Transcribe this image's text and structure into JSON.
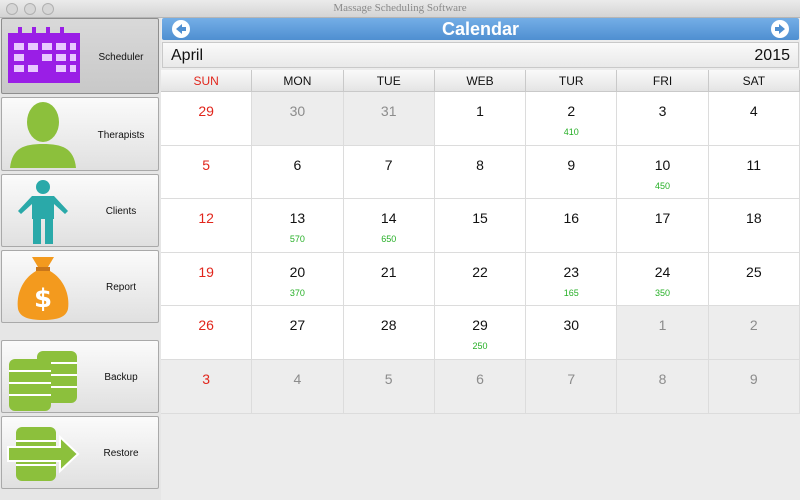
{
  "window": {
    "title": "Massage Scheduling Software"
  },
  "sidebar": {
    "items": [
      {
        "label": "Scheduler",
        "icon": "calendar-icon",
        "active": true
      },
      {
        "label": "Therapists",
        "icon": "person-icon",
        "active": false
      },
      {
        "label": "Clients",
        "icon": "client-icon",
        "active": false
      },
      {
        "label": "Report",
        "icon": "money-bag-icon",
        "active": false
      },
      {
        "label": "Backup",
        "icon": "database-icon",
        "active": false
      },
      {
        "label": "Restore",
        "icon": "restore-icon",
        "active": false
      }
    ]
  },
  "calendar": {
    "title": "Calendar",
    "month": "April",
    "year": "2015",
    "weekdays": [
      "SUN",
      "MON",
      "TUE",
      "WEB",
      "TUR",
      "FRI",
      "SAT"
    ],
    "weeks": [
      [
        {
          "day": "29",
          "current": true
        },
        {
          "day": "30",
          "current": false
        },
        {
          "day": "31",
          "current": false
        },
        {
          "day": "1",
          "current": true
        },
        {
          "day": "2",
          "current": true,
          "amount": "410"
        },
        {
          "day": "3",
          "current": true
        },
        {
          "day": "4",
          "current": true
        }
      ],
      [
        {
          "day": "5",
          "current": true
        },
        {
          "day": "6",
          "current": true
        },
        {
          "day": "7",
          "current": true
        },
        {
          "day": "8",
          "current": true
        },
        {
          "day": "9",
          "current": true
        },
        {
          "day": "10",
          "current": true,
          "amount": "450"
        },
        {
          "day": "11",
          "current": true
        }
      ],
      [
        {
          "day": "12",
          "current": true
        },
        {
          "day": "13",
          "current": true,
          "amount": "570"
        },
        {
          "day": "14",
          "current": true,
          "amount": "650"
        },
        {
          "day": "15",
          "current": true
        },
        {
          "day": "16",
          "current": true
        },
        {
          "day": "17",
          "current": true
        },
        {
          "day": "18",
          "current": true
        }
      ],
      [
        {
          "day": "19",
          "current": true
        },
        {
          "day": "20",
          "current": true,
          "amount": "370"
        },
        {
          "day": "21",
          "current": true
        },
        {
          "day": "22",
          "current": true
        },
        {
          "day": "23",
          "current": true,
          "amount": "165"
        },
        {
          "day": "24",
          "current": true,
          "amount": "350"
        },
        {
          "day": "25",
          "current": true
        }
      ],
      [
        {
          "day": "26",
          "current": true
        },
        {
          "day": "27",
          "current": true
        },
        {
          "day": "28",
          "current": true
        },
        {
          "day": "29",
          "current": true,
          "amount": "250"
        },
        {
          "day": "30",
          "current": true
        },
        {
          "day": "1",
          "current": false
        },
        {
          "day": "2",
          "current": false
        }
      ],
      [
        {
          "day": "3",
          "current": false
        },
        {
          "day": "4",
          "current": false
        },
        {
          "day": "5",
          "current": false
        },
        {
          "day": "6",
          "current": false
        },
        {
          "day": "7",
          "current": false
        },
        {
          "day": "8",
          "current": false
        },
        {
          "day": "9",
          "current": false
        }
      ]
    ]
  },
  "colors": {
    "header_blue": "#5b9ad9",
    "sunday_red": "#e1261c",
    "amount_green": "#27b027",
    "icon_purple": "#9a1ee6",
    "icon_green": "#8cc03c",
    "icon_teal": "#2aa9a9",
    "icon_orange": "#f39a1e"
  }
}
